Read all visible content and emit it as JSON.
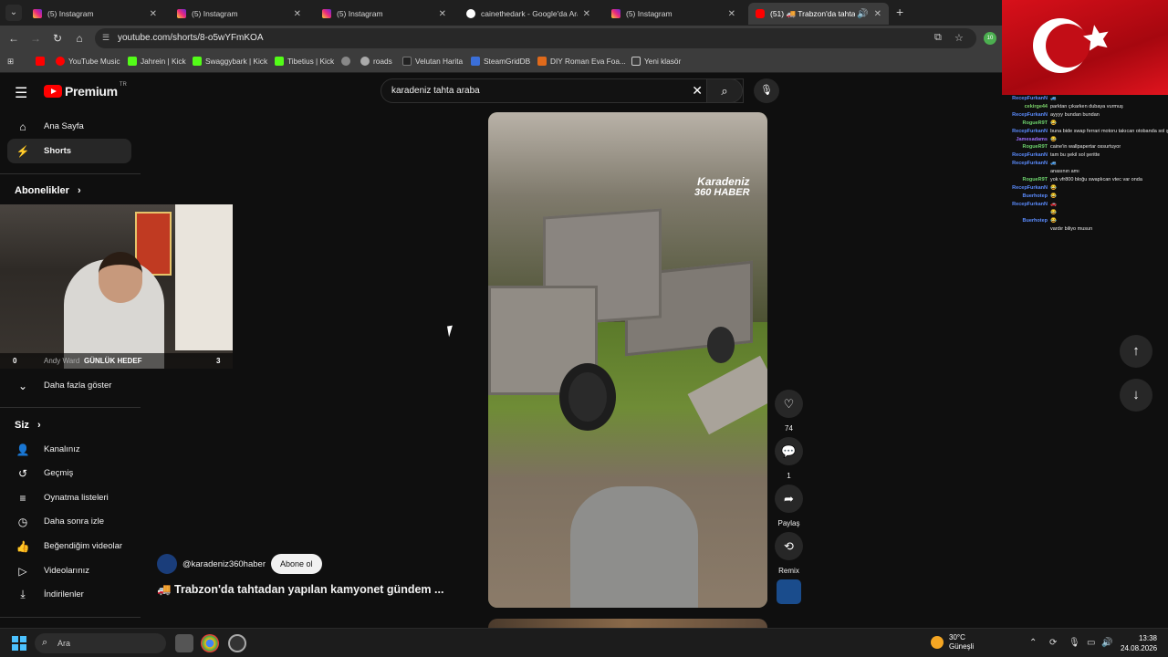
{
  "browser": {
    "tabs": [
      {
        "title": "(5) Instagram",
        "type": "ig"
      },
      {
        "title": "(5) Instagram",
        "type": "ig"
      },
      {
        "title": "(5) Instagram",
        "type": "ig"
      },
      {
        "title": "cainethedark - Google'da Ara",
        "type": "g"
      },
      {
        "title": "(5) Instagram",
        "type": "ig"
      },
      {
        "title": "(51) 🚚 Trabzon'da tahtada",
        "type": "yt"
      }
    ],
    "url": "youtube.com/shorts/8-o5wYFmKOA",
    "extension_badge": "10",
    "bookmarks": [
      {
        "label": "YouTube Music",
        "color": "#ff0000"
      },
      {
        "label": "Jahrein | Kick",
        "color": "#53fc18"
      },
      {
        "label": "Swaggybark | Kick",
        "color": "#53fc18"
      },
      {
        "label": "Tibetius | Kick",
        "color": "#53fc18"
      },
      {
        "label": "",
        "color": "#888888"
      },
      {
        "label": "roads",
        "color": "#aaaaaa"
      },
      {
        "label": "Velutan Harita",
        "color": "#222222"
      },
      {
        "label": "SteamGridDB",
        "color": "#3b6fd8"
      },
      {
        "label": "DIY Roman Eva Foa...",
        "color": "#e06a1b"
      },
      {
        "label": "Yeni klasör",
        "color": "#cccccc"
      }
    ]
  },
  "youtube": {
    "logo_text": "Premium",
    "logo_region": "TR",
    "search_query": "karadeniz tahta araba",
    "nav_main": [
      {
        "label": "Ana Sayfa",
        "icon": "home-icon"
      },
      {
        "label": "Shorts",
        "icon": "shorts-icon"
      }
    ],
    "subscriptions_header": "Abonelikler",
    "subscription_partial": "Andy Ward",
    "show_more": "Daha fazla göster",
    "you_header": "Siz",
    "nav_you": [
      {
        "label": "Kanalınız",
        "icon": "channel-icon"
      },
      {
        "label": "Geçmiş",
        "icon": "history-icon"
      },
      {
        "label": "Oynatma listeleri",
        "icon": "playlists-icon"
      },
      {
        "label": "Daha sonra izle",
        "icon": "watch-later-icon"
      },
      {
        "label": "Beğendiğim videolar",
        "icon": "liked-icon"
      },
      {
        "label": "Videolarınız",
        "icon": "videos-icon"
      },
      {
        "label": "İndirilenler",
        "icon": "downloads-icon"
      }
    ],
    "short": {
      "watermark_line1": "Karadeniz",
      "watermark_line2": "360 HABER",
      "likes": "74",
      "comments": "1",
      "share_label": "Paylaş",
      "remix_label": "Remix",
      "channel_handle": "@karadeniz360haber",
      "subscribe_label": "Abone ol",
      "title": "🚚 Trabzon'da tahtadan yapılan kamyonet gündem ..."
    }
  },
  "webcam_overlay": {
    "left_value": "0",
    "goal_label": "GÜNLÜK HEDEF",
    "goal_value": "3"
  },
  "chat": [
    {
      "user": "RecepFurkanN",
      "color": "#5b8cff",
      "msg": "🚙"
    },
    {
      "user": "cekirge44",
      "color": "#7cd36a",
      "msg": "parktan çıkarken dubaya vurmuş"
    },
    {
      "user": "RecepFurkanN",
      "color": "#5b8cff",
      "msg": "ayyyy bundan bundan"
    },
    {
      "user": "RogueR9T",
      "color": "#6ed46e",
      "msg": "😂"
    },
    {
      "user": "RecepFurkanN",
      "color": "#5b8cff",
      "msg": "buna bide swap ferrari motoru takıcan otobanda sol şerit faresi olacan bappa vutuuuuuuuuuu tu tu tu tuuuuuu"
    },
    {
      "user": "Jamesadams",
      "color": "#9b6cff",
      "msg": "😂"
    },
    {
      "user": "RogueR9T",
      "color": "#6ed46e",
      "msg": "caine'in wallpapertar ossurtuyor"
    },
    {
      "user": "RecepFurkanN",
      "color": "#5b8cff",
      "msg": "tam bu şekil sol şeritte"
    },
    {
      "user": "RecepFurkanN",
      "color": "#5b8cff",
      "msg": "🚙"
    },
    {
      "user": "",
      "color": "#ff4d4d",
      "msg": "anasının amı"
    },
    {
      "user": "RogueR9T",
      "color": "#6ed46e",
      "msg": "yok vfr800 bloğu swaplıcan vtec var onda"
    },
    {
      "user": "RecepFurkanN",
      "color": "#5b8cff",
      "msg": "😂"
    },
    {
      "user": "Buerhotep",
      "color": "#5b8cff",
      "msg": "😂"
    },
    {
      "user": "RecepFurkanN",
      "color": "#5b8cff",
      "msg": "🚗"
    },
    {
      "user": "",
      "color": "#ff4d4d",
      "msg": "😂"
    },
    {
      "user": "Buerhotep",
      "color": "#5b8cff",
      "msg": "😂"
    },
    {
      "user": "",
      "color": "#ff4d4d",
      "msg": "vardır biliyo musun"
    }
  ],
  "taskbar": {
    "search_placeholder": "Ara",
    "weather_temp": "30°C",
    "weather_desc": "Güneşli",
    "time": "13:38",
    "date": "24.08.2026"
  }
}
